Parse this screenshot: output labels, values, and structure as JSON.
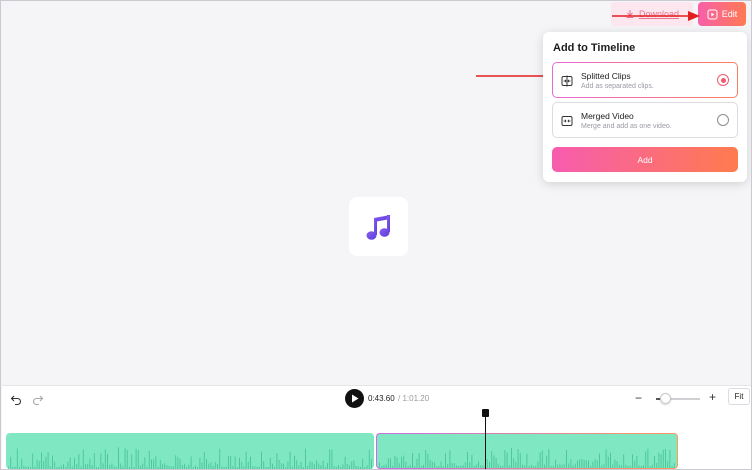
{
  "header": {
    "download_label": "Download",
    "edit_label": "Edit"
  },
  "popup": {
    "title": "Add to Timeline",
    "options": [
      {
        "title": "Splitted Clips",
        "subtitle": "Add as separated clips.",
        "selected": true,
        "icon": "split-clips-icon"
      },
      {
        "title": "Merged Video",
        "subtitle": "Merge and add as one video.",
        "selected": false,
        "icon": "merge-video-icon"
      }
    ],
    "add_label": "Add"
  },
  "player": {
    "current_time": "0:43.60",
    "total_time": "/ 1:01.20",
    "media_icon": "music-note-icon"
  },
  "toolbar": {
    "undo_icon": "undo-icon",
    "redo_icon": "redo-icon",
    "zoom_minus": "−",
    "zoom_plus": "+",
    "zoom_level": 0.2,
    "fit_label": "Fit"
  },
  "timeline": {
    "clips": [
      {
        "name": "clip-1",
        "selected": false
      },
      {
        "name": "clip-2",
        "selected": true
      }
    ]
  },
  "colors": {
    "accent_start": "#f75fa8",
    "accent_end": "#ff7a52",
    "clip_fill": "#7fe8c3",
    "annotation_arrow": "#e31e1e"
  }
}
